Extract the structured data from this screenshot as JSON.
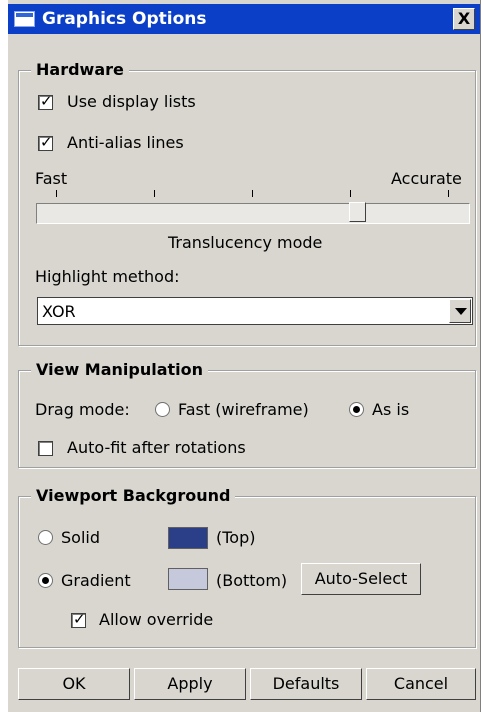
{
  "window": {
    "title": "Graphics Options",
    "close_label": "X"
  },
  "hardware": {
    "title": "Hardware",
    "use_display_lists": {
      "label": "Use display lists",
      "checked": true
    },
    "anti_alias_lines": {
      "label": "Anti-alias lines",
      "checked": true
    },
    "slider": {
      "left_label": "Fast",
      "right_label": "Accurate",
      "caption": "Translucency mode",
      "ticks": 5,
      "value_fraction": 0.78
    },
    "highlight_label": "Highlight method:",
    "highlight_value": "XOR"
  },
  "view_manipulation": {
    "title": "View Manipulation",
    "drag_mode_label": "Drag mode:",
    "options": [
      {
        "label": "Fast (wireframe)",
        "selected": false
      },
      {
        "label": "As is",
        "selected": true
      }
    ],
    "auto_fit": {
      "label": "Auto-fit after rotations",
      "checked": false
    }
  },
  "viewport_background": {
    "title": "Viewport Background",
    "solid": {
      "label": "Solid",
      "selected": false,
      "swatch_color": "#2a3f88",
      "swatch_label": "(Top)"
    },
    "gradient": {
      "label": "Gradient",
      "selected": true,
      "swatch_color": "#c6c8dc",
      "swatch_label": "(Bottom)"
    },
    "auto_select_label": "Auto-Select",
    "allow_override": {
      "label": "Allow override",
      "checked": true
    }
  },
  "buttons": {
    "ok": "OK",
    "apply": "Apply",
    "defaults": "Defaults",
    "cancel": "Cancel"
  }
}
